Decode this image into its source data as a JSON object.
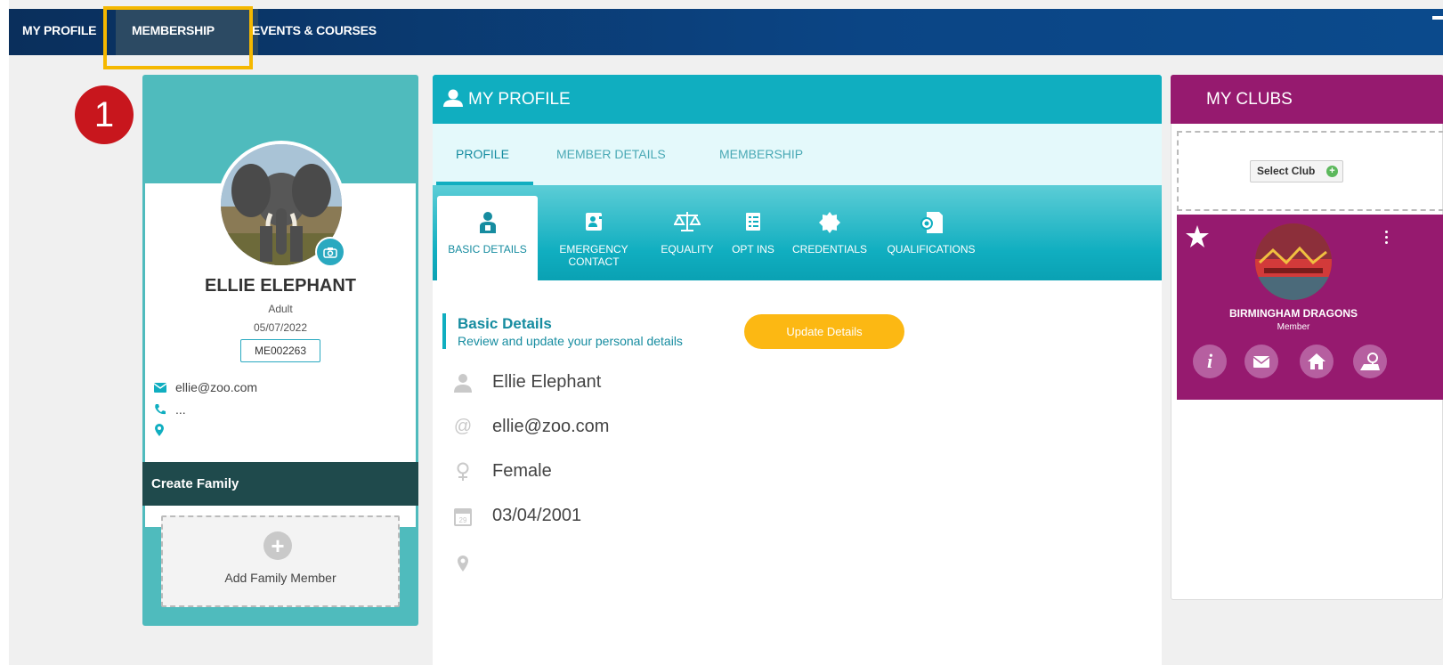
{
  "topnav": {
    "items": [
      "MY PROFILE",
      "MEMBERSHIP",
      "EVENTS & COURSES"
    ],
    "active": "MEMBERSHIP"
  },
  "annotation": {
    "step": "1"
  },
  "profile_card": {
    "name": "ELLIE ELEPHANT",
    "type": "Adult",
    "date": "05/07/2022",
    "member_id": "ME002263",
    "email": "ellie@zoo.com",
    "phone": "...",
    "location": "",
    "create_family": "Create Family",
    "add_family_member": "Add Family Member"
  },
  "my_profile": {
    "title": "MY PROFILE",
    "subtabs": [
      "PROFILE",
      "MEMBER DETAILS",
      "MEMBERSHIP"
    ],
    "icon_tabs": [
      {
        "label": "BASIC DETAILS",
        "icon": "person-badge-icon"
      },
      {
        "label": "EMERGENCY CONTACT",
        "icon": "contact-card-icon"
      },
      {
        "label": "EQUALITY",
        "icon": "scales-icon"
      },
      {
        "label": "OPT INS",
        "icon": "checklist-icon"
      },
      {
        "label": "CREDENTIALS",
        "icon": "seal-icon"
      },
      {
        "label": "QUALIFICATIONS",
        "icon": "certificate-icon"
      }
    ],
    "section_title": "Basic Details",
    "section_subtitle": "Review and update your personal details",
    "update_button": "Update Details",
    "details": {
      "name": "Ellie Elephant",
      "email": "ellie@zoo.com",
      "gender": "Female",
      "dob": "03/04/2001",
      "address": ""
    }
  },
  "my_clubs": {
    "title": "MY CLUBS",
    "select_club": "Select Club",
    "club": {
      "name": "BIRMINGHAM DRAGONS",
      "role": "Member"
    }
  },
  "colors": {
    "nav": "#0b4585",
    "teal": "#10aec0",
    "left_card": "#4fbbbd",
    "clubs": "#961a6f",
    "update": "#fcb813",
    "highlight": "#f5b800",
    "step_badge": "#c8161d"
  }
}
